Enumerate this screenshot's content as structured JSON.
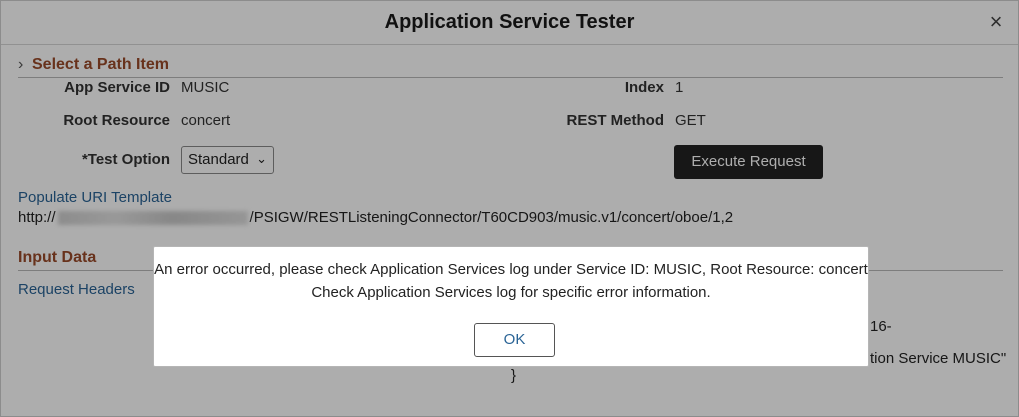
{
  "dialog": {
    "title": "Application Service Tester",
    "close_glyph": "×"
  },
  "path_section": {
    "chevron_glyph": "›",
    "header": "Select a Path Item",
    "app_service_id_label": "App Service ID",
    "app_service_id_value": "MUSIC",
    "index_label": "Index",
    "index_value": "1",
    "root_resource_label": "Root Resource",
    "root_resource_value": "concert",
    "rest_method_label": "REST Method",
    "rest_method_value": "GET",
    "test_option_label": "*Test Option",
    "test_option_selected": "Standard",
    "execute_label": "Execute Request",
    "populate_link": "Populate URI Template",
    "url_prefix": "http://",
    "url_suffix": "/PSIGW/RESTListeningConnector/T60CD903/music.v1/concert/oboe/1,2"
  },
  "input_section": {
    "header": "Input Data",
    "request_headers_link": "Request Headers",
    "partial_text_1": "16-",
    "partial_text_2": "tion Service MUSIC\"",
    "partial_text_3": "}"
  },
  "modal": {
    "message_line1": "An error occurred, please check Application Services log under Service ID: MUSIC, Root Resource: concert",
    "message_line2": "Check Application Services log for specific error information.",
    "ok_label": "OK"
  },
  "colors": {
    "section_header": "#9a4a2a",
    "link": "#2a6496",
    "primary_button": "#222222"
  }
}
